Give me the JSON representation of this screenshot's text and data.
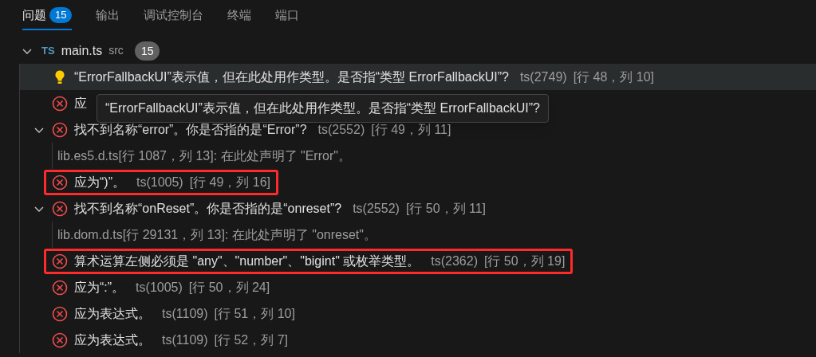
{
  "tabs": [
    {
      "label": "问题",
      "badge": "15",
      "selected": true
    },
    {
      "label": "输出",
      "selected": false
    },
    {
      "label": "调试控制台",
      "selected": false
    },
    {
      "label": "终端",
      "selected": false
    },
    {
      "label": "端口",
      "selected": false
    }
  ],
  "file": {
    "lang": "TS",
    "name": "main.ts",
    "path": "src",
    "count": "15",
    "expanded": true,
    "problems": [
      {
        "kind": "info",
        "message": "“ErrorFallbackUI”表示值，但在此处用作类型。是否指“类型 ErrorFallbackUI”?",
        "code": "ts(2749)",
        "location": "[行 48，列 10]",
        "selected": true,
        "highlighted": false
      },
      {
        "kind": "error",
        "message": "应",
        "selected": false,
        "highlighted": false
      },
      {
        "kind": "error",
        "message": "找不到名称“error”。你是否指的是“Error”?",
        "code": "ts(2552)",
        "location": "[行 49，列 11]",
        "expanded": true,
        "related": [
          "lib.es5.d.ts[行 1087，列 13]: 在此处声明了 \"Error\"。"
        ],
        "selected": false,
        "highlighted": false
      },
      {
        "kind": "error",
        "message": "应为“)”。",
        "code": "ts(1005)",
        "location": "[行 49，列 16]",
        "selected": false,
        "highlighted": true
      },
      {
        "kind": "error",
        "message": "找不到名称“onReset”。你是否指的是“onreset”?",
        "code": "ts(2552)",
        "location": "[行 50，列 11]",
        "expanded": true,
        "related": [
          "lib.dom.d.ts[行 29131，列 13]: 在此处声明了 \"onreset\"。"
        ],
        "selected": false,
        "highlighted": false
      },
      {
        "kind": "error",
        "message": "算术运算左侧必须是 \"any\"、\"number\"、\"bigint\" 或枚举类型。",
        "code": "ts(2362)",
        "location": "[行 50，列 19]",
        "selected": false,
        "highlighted": true
      },
      {
        "kind": "error",
        "message": "应为“:”。",
        "code": "ts(1005)",
        "location": "[行 50，列 24]",
        "selected": false,
        "highlighted": false
      },
      {
        "kind": "error",
        "message": "应为表达式。",
        "code": "ts(1109)",
        "location": "[行 51，列 10]",
        "selected": false,
        "highlighted": false
      },
      {
        "kind": "error",
        "message": "应为表达式。",
        "code": "ts(1109)",
        "location": "[行 52，列 7]",
        "selected": false,
        "highlighted": false
      }
    ]
  },
  "tooltip": {
    "text": "“ErrorFallbackUI”表示值，但在此处用作类型。是否指“类型 ErrorFallbackUI”?"
  }
}
